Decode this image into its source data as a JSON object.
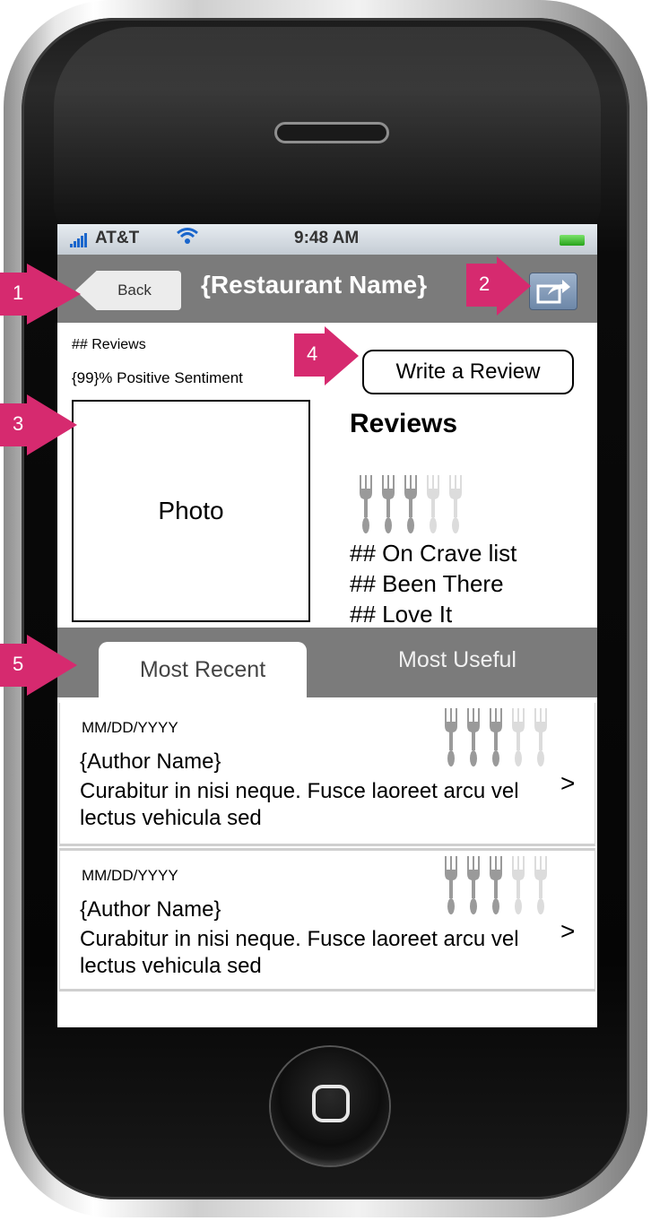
{
  "status_bar": {
    "carrier": "AT&T",
    "time": "9:48 AM"
  },
  "nav": {
    "back_label": "Back",
    "title": "{Restaurant Name}"
  },
  "summary": {
    "reviews_count": "## Reviews",
    "sentiment": "{99}% Positive Sentiment",
    "write_review_label": "Write a Review",
    "photo_label": "Photo",
    "reviews_heading": "Reviews",
    "rating_forks": {
      "filled": 3,
      "total": 5
    },
    "stats": [
      "## On Crave list",
      "## Been There",
      "## Love It"
    ]
  },
  "tabs": {
    "most_recent": "Most Recent",
    "most_useful": "Most Useful"
  },
  "reviews": [
    {
      "date": "MM/DD/YYYY",
      "author": "{Author Name}",
      "text": "Curabitur in nisi neque. Fusce laoreet arcu vel lectus vehicula sed",
      "arrow": ">",
      "rating_forks": {
        "filled": 3,
        "total": 5
      }
    },
    {
      "date": "MM/DD/YYYY",
      "author": "{Author Name}",
      "text": "Curabitur in nisi neque. Fusce laoreet arcu vel lectus vehicula sed",
      "arrow": ">",
      "rating_forks": {
        "filled": 3,
        "total": 5
      }
    }
  ],
  "callouts": [
    "1",
    "2",
    "3",
    "4",
    "5"
  ],
  "colors": {
    "callout": "#d62a6f",
    "navbar": "#7b7b7b",
    "fork_filled": "#9a9a9a",
    "fork_empty": "#dcdcdc"
  }
}
